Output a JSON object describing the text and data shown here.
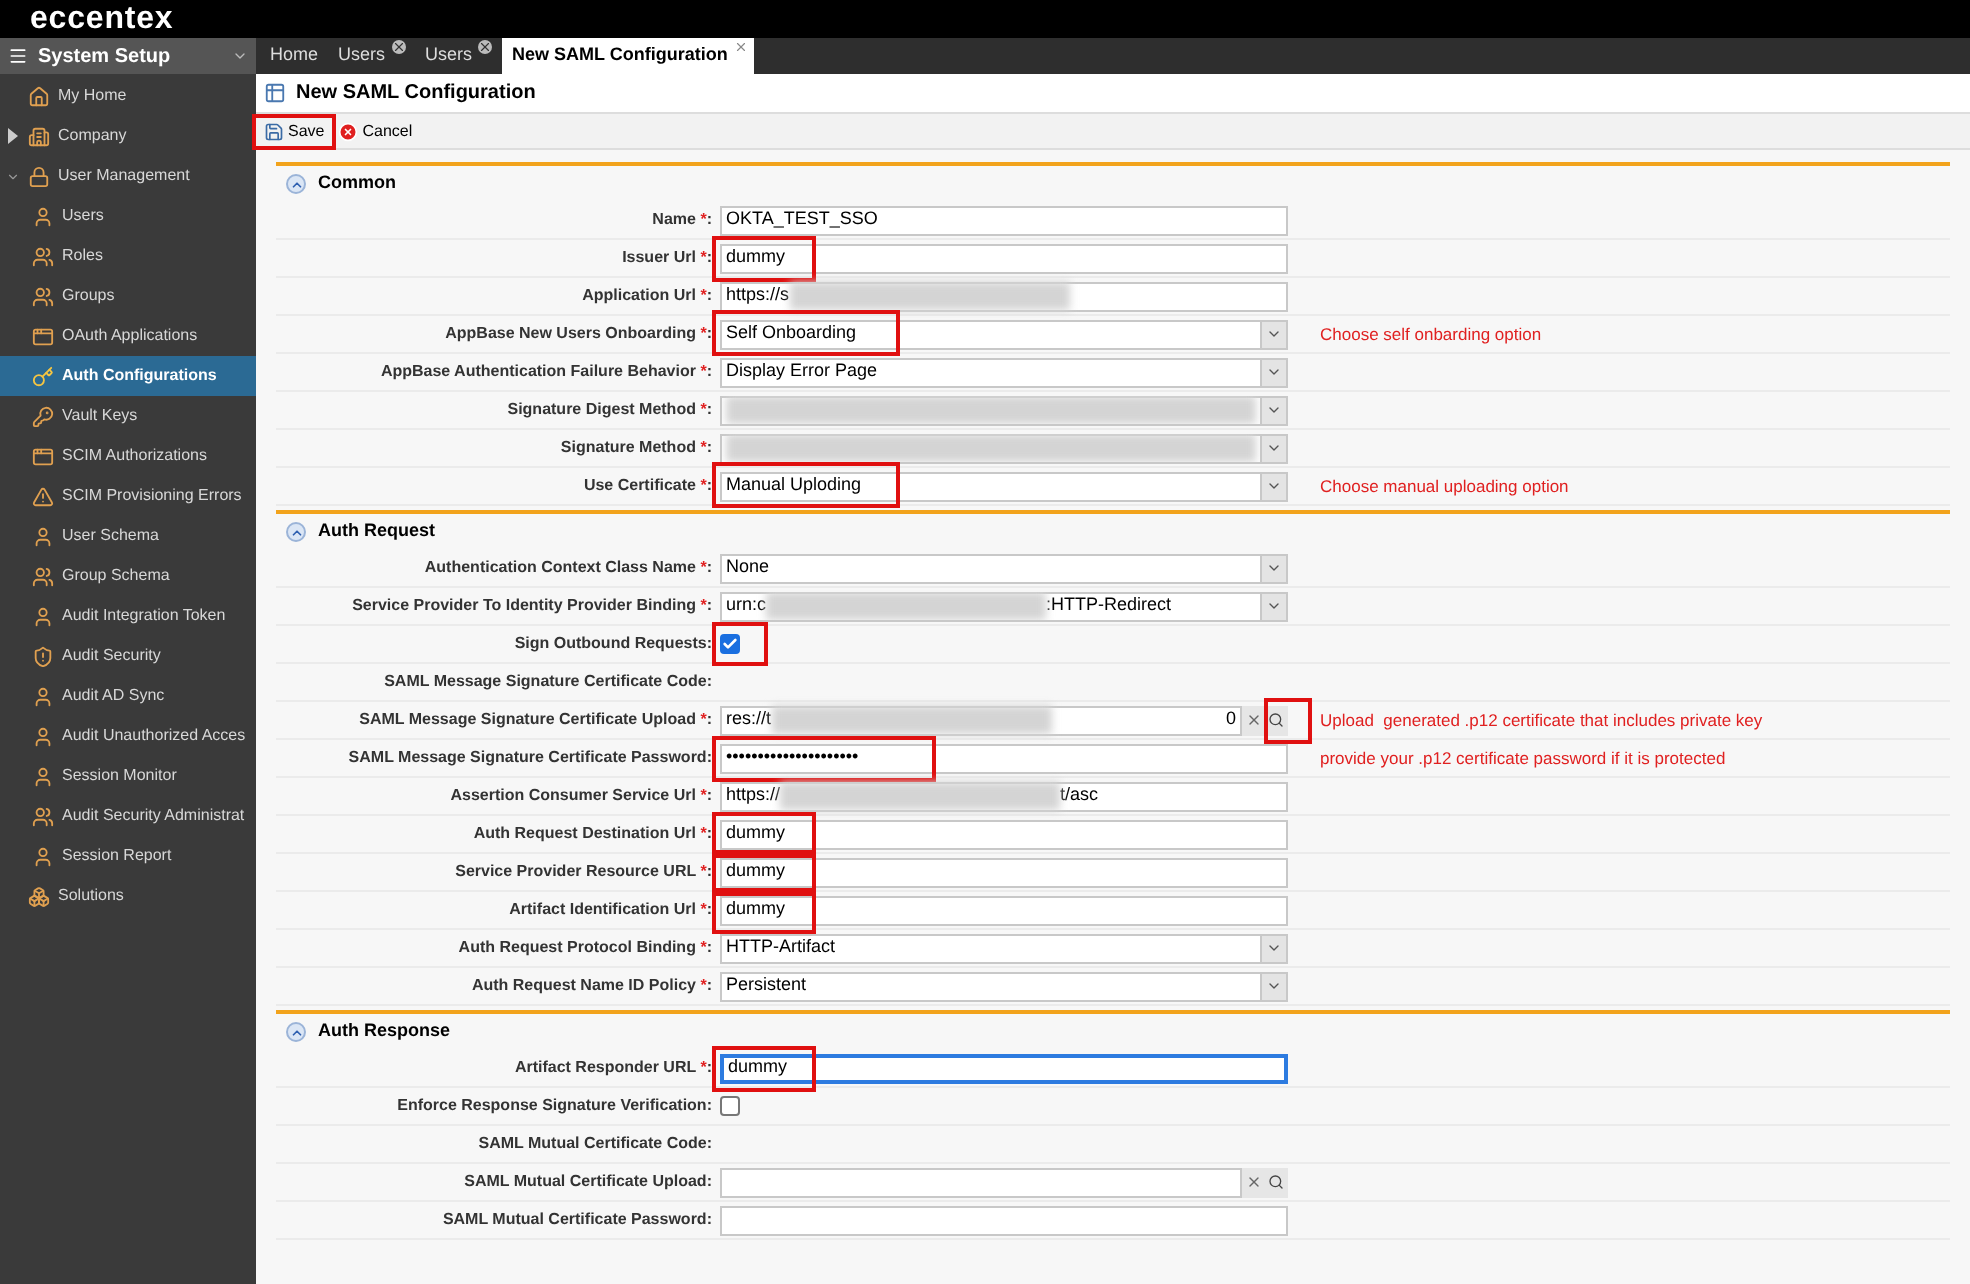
{
  "app": {
    "logo": "eccentex"
  },
  "sidebar": {
    "title": "System Setup",
    "items": [
      {
        "label": "My Home",
        "selected": false
      },
      {
        "label": "Company",
        "selected": false,
        "expanded": false
      },
      {
        "label": "User Management",
        "selected": false,
        "expanded": true,
        "children": [
          {
            "label": "Users",
            "selected": false
          },
          {
            "label": "Roles",
            "selected": false
          },
          {
            "label": "Groups",
            "selected": false
          },
          {
            "label": "OAuth Applications",
            "selected": false
          },
          {
            "label": "Auth Configurations",
            "selected": true
          },
          {
            "label": "Vault Keys",
            "selected": false
          },
          {
            "label": "SCIM Authorizations",
            "selected": false
          },
          {
            "label": "SCIM Provisioning Errors",
            "selected": false
          },
          {
            "label": "User Schema",
            "selected": false
          },
          {
            "label": "Group Schema",
            "selected": false
          },
          {
            "label": "Audit Integration Token",
            "selected": false
          },
          {
            "label": "Audit Security",
            "selected": false
          },
          {
            "label": "Audit AD Sync",
            "selected": false
          },
          {
            "label": "Audit Unauthorized Acces",
            "selected": false
          },
          {
            "label": "Session Monitor",
            "selected": false
          },
          {
            "label": "Audit Security Administrat",
            "selected": false
          },
          {
            "label": "Session Report",
            "selected": false
          }
        ]
      },
      {
        "label": "Solutions",
        "selected": false
      }
    ]
  },
  "tabs": [
    {
      "label": "Home",
      "selected": false,
      "closable": false
    },
    {
      "label": "Users",
      "selected": false,
      "closable": true
    },
    {
      "label": "Users",
      "selected": false,
      "closable": true
    },
    {
      "label": "New SAML Configuration",
      "selected": true,
      "closable": true
    }
  ],
  "page": {
    "title": "New SAML Configuration"
  },
  "toolbar": {
    "save": {
      "label": "Save",
      "highlighted": true
    },
    "cancel": {
      "label": "Cancel"
    }
  },
  "form": {
    "required_mark": "*",
    "label_suffix": ":",
    "sections": [
      {
        "title": "Common",
        "expanded": true,
        "rows": [
          {
            "kind": "text",
            "label": "Name",
            "required": true,
            "value": "OKTA_TEST_SSO"
          },
          {
            "kind": "text",
            "label": "Issuer Url",
            "required": true,
            "value": "dummy",
            "highlighted": true
          },
          {
            "kind": "text",
            "label": "Application Url",
            "required": true,
            "value": "https://s",
            "redacted": true
          },
          {
            "kind": "select",
            "label": "AppBase New Users Onboarding",
            "required": true,
            "value": "Self Onboarding",
            "highlighted": true,
            "note": "Choose self onbarding option"
          },
          {
            "kind": "select",
            "label": "AppBase Authentication Failure Behavior",
            "required": true,
            "value": "Display Error Page"
          },
          {
            "kind": "select",
            "label": "Signature Digest Method",
            "required": true,
            "redacted": true
          },
          {
            "kind": "select",
            "label": "Signature Method",
            "required": true,
            "redacted": true
          },
          {
            "kind": "select",
            "label": "Use Certificate",
            "required": true,
            "value": "Manual Uploding",
            "highlighted": true,
            "note": "Choose manual uploading option"
          }
        ]
      },
      {
        "title": "Auth Request",
        "expanded": true,
        "rows": [
          {
            "kind": "select",
            "label": "Authentication Context Class Name",
            "required": true,
            "value": "None"
          },
          {
            "kind": "select",
            "label": "Service Provider To Identity Provider Binding",
            "required": true,
            "value": "urn:c",
            "redacted": true,
            "value_end": ":HTTP-Redirect"
          },
          {
            "kind": "checkbox",
            "label": "Sign Outbound Requests",
            "required": false,
            "checked": true,
            "highlighted": true
          },
          {
            "kind": "static",
            "label": "SAML Message Signature Certificate Code",
            "required": false
          },
          {
            "kind": "upload",
            "label": "SAML Message Signature Certificate Upload",
            "required": true,
            "value": "res://t",
            "redacted": true,
            "value_end": "0",
            "highlighted": true,
            "note": "Upload  generated .p12 certificate that includes private key"
          },
          {
            "kind": "text",
            "label": "SAML Message Signature Certificate Password",
            "required": false,
            "value": "•••••••••••••••••••••",
            "highlighted": true,
            "note": "provide your .p12 certificate password if it is protected"
          },
          {
            "kind": "text",
            "label": "Assertion Consumer Service Url",
            "required": true,
            "value": "https://",
            "redacted": true,
            "value_end": "t/asc"
          },
          {
            "kind": "text",
            "label": "Auth Request Destination Url",
            "required": true,
            "value": "dummy",
            "highlighted": true
          },
          {
            "kind": "text",
            "label": "Service Provider Resource URL",
            "required": true,
            "value": "dummy",
            "highlighted": true
          },
          {
            "kind": "text",
            "label": "Artifact Identification Url",
            "required": true,
            "value": "dummy",
            "highlighted": true
          },
          {
            "kind": "select",
            "label": "Auth Request Protocol Binding",
            "required": true,
            "value": "HTTP-Artifact"
          },
          {
            "kind": "select",
            "label": "Auth Request Name ID Policy",
            "required": true,
            "value": "Persistent"
          }
        ]
      },
      {
        "title": "Auth Response",
        "expanded": true,
        "rows": [
          {
            "kind": "text",
            "label": "Artifact Responder URL",
            "required": true,
            "value": "dummy",
            "highlighted": true,
            "focused": true
          },
          {
            "kind": "checkbox",
            "label": "Enforce Response Signature Verification",
            "required": false,
            "checked": false
          },
          {
            "kind": "static",
            "label": "SAML Mutual Certificate Code",
            "required": false
          },
          {
            "kind": "upload",
            "label": "SAML Mutual Certificate Upload",
            "required": false
          },
          {
            "kind": "text",
            "label": "SAML Mutual Certificate Password",
            "required": false
          }
        ]
      }
    ]
  }
}
